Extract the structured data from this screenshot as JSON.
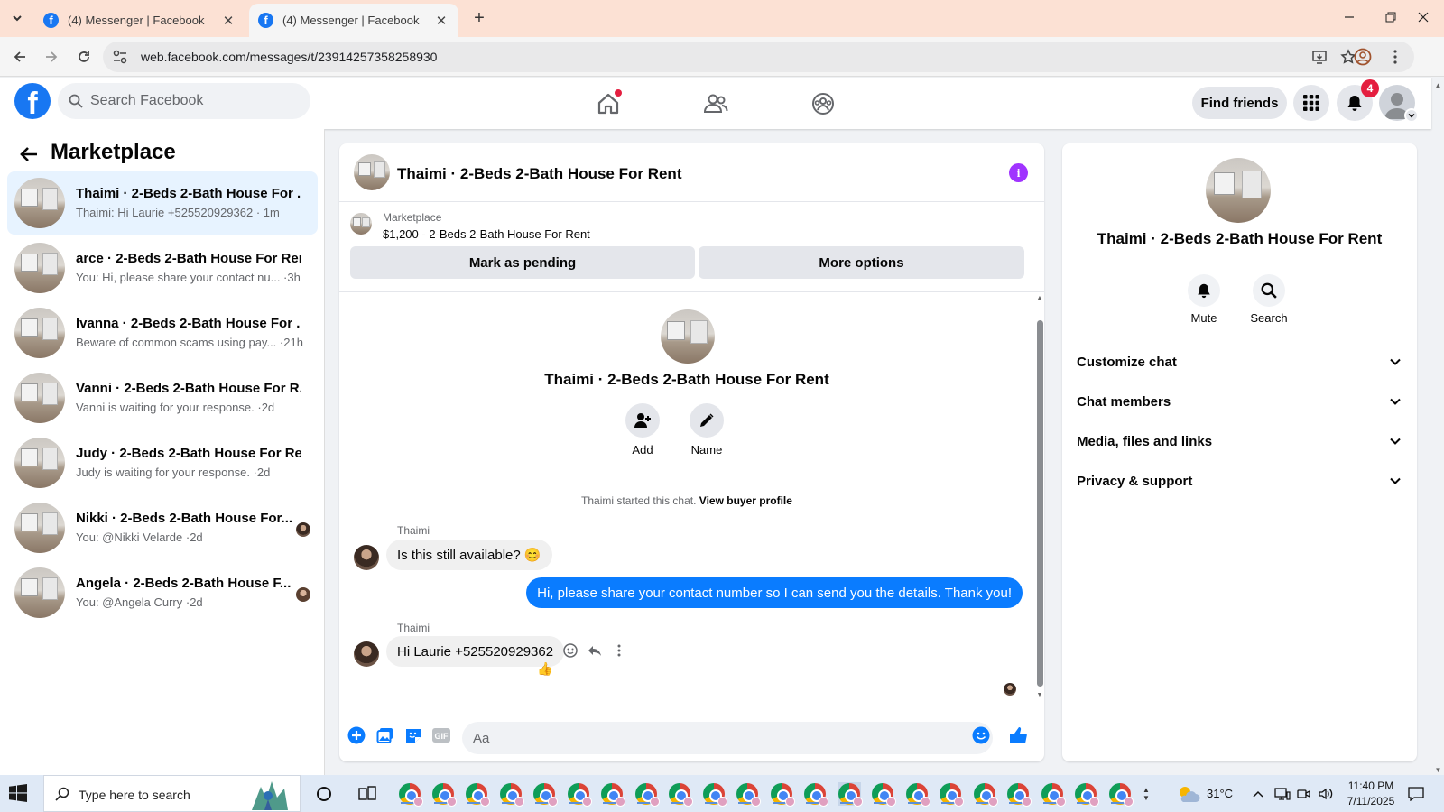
{
  "browser": {
    "tabs": [
      {
        "title": "(4) Messenger | Facebook",
        "active": false
      },
      {
        "title": "(4) Messenger | Facebook",
        "active": true
      }
    ],
    "url": "web.facebook.com/messages/t/23914257358258930"
  },
  "fb": {
    "search_placeholder": "Search Facebook",
    "find_friends": "Find friends",
    "notification_count": "4",
    "colors": {
      "brand": "#1877f2",
      "badge": "#e41e3f",
      "outgoing_bubble": "#0a7cff",
      "info_icon": "#a033ff"
    }
  },
  "sidebar": {
    "title": "Marketplace",
    "conversations": [
      {
        "name": "Thaimi · 2-Beds 2-Bath House For ...",
        "preview": "Thaimi: Hi Laurie +525520929362",
        "time": "1m",
        "selected": true
      },
      {
        "name": "arce · 2-Beds 2-Bath House For Rent",
        "preview": "You: Hi, please share your contact nu...",
        "time": "3h"
      },
      {
        "name": "Ivanna · 2-Beds 2-Bath House For ...",
        "preview": "Beware of common scams using pay...",
        "time": "21h"
      },
      {
        "name": "Vanni · 2-Beds 2-Bath House For R...",
        "preview": "Vanni is waiting for your response.",
        "time": "2d"
      },
      {
        "name": "Judy · 2-Beds 2-Bath House For Re...",
        "preview": "Judy is waiting for your response.",
        "time": "2d"
      },
      {
        "name": "Nikki · 2-Beds 2-Bath House For...",
        "preview": "You: @Nikki Velarde",
        "time": "2d"
      },
      {
        "name": "Angela · 2-Beds 2-Bath House F...",
        "preview": "You: @Angela Curry",
        "time": "2d"
      }
    ]
  },
  "chat": {
    "title": "Thaimi · 2-Beds 2-Bath House For Rent",
    "marketplace_label": "Marketplace",
    "listing": "$1,200 - 2-Beds 2-Bath House For Rent",
    "mark_pending": "Mark as pending",
    "more_options": "More options",
    "intro_name": "Thaimi · 2-Beds 2-Bath House For Rent",
    "add_label": "Add",
    "name_label": "Name",
    "started_text": "Thaimi started this chat.",
    "view_profile": "View buyer profile",
    "messages": [
      {
        "sender": "Thaimi",
        "text": "Is this still available? 😊"
      },
      {
        "text": "Hi, please share your contact number so I can send you the details. Thank you!"
      },
      {
        "sender": "Thaimi",
        "text": "Hi Laurie +525520929362",
        "reaction": "👍"
      }
    ],
    "composer_placeholder": "Aa",
    "gif_label": "GIF"
  },
  "details": {
    "name": "Thaimi · 2-Beds 2-Bath House For Rent",
    "mute": "Mute",
    "search": "Search",
    "sections": [
      "Customize chat",
      "Chat members",
      "Media, files and links",
      "Privacy & support"
    ]
  },
  "taskbar": {
    "search_placeholder": "Type here to search",
    "temperature": "31°C",
    "time": "11:40 PM",
    "date": "7/11/2025"
  }
}
